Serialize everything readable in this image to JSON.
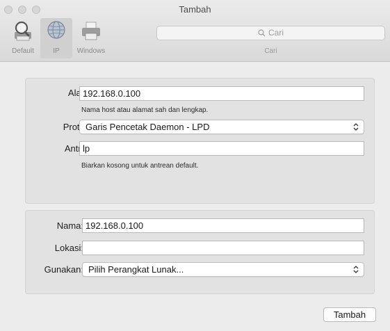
{
  "window": {
    "title": "Tambah"
  },
  "toolbar": {
    "items": [
      {
        "label": "Default",
        "icon": "magnifier-printer-icon"
      },
      {
        "label": "IP",
        "icon": "globe-icon",
        "selected": true
      },
      {
        "label": "Windows",
        "icon": "printer-icon"
      }
    ],
    "search_placeholder": "Cari",
    "search_caption": "Cari"
  },
  "ip_panel": {
    "address_label": "Alamat:",
    "address_value": "192.168.0.100",
    "address_hint": "Nama host atau alamat sah dan lengkap.",
    "protocol_label": "Protokol:",
    "protocol_value": "Garis Pencetak Daemon - LPD",
    "queue_label": "Antrean:",
    "queue_value": "lp",
    "queue_hint": "Biarkan kosong untuk antrean default."
  },
  "printer_panel": {
    "name_label": "Nama:",
    "name_value": "192.168.0.100",
    "location_label": "Lokasi:",
    "location_value": "",
    "use_label": "Gunakan:",
    "use_value": "Pilih Perangkat Lunak..."
  },
  "footer": {
    "add_button": "Tambah"
  }
}
